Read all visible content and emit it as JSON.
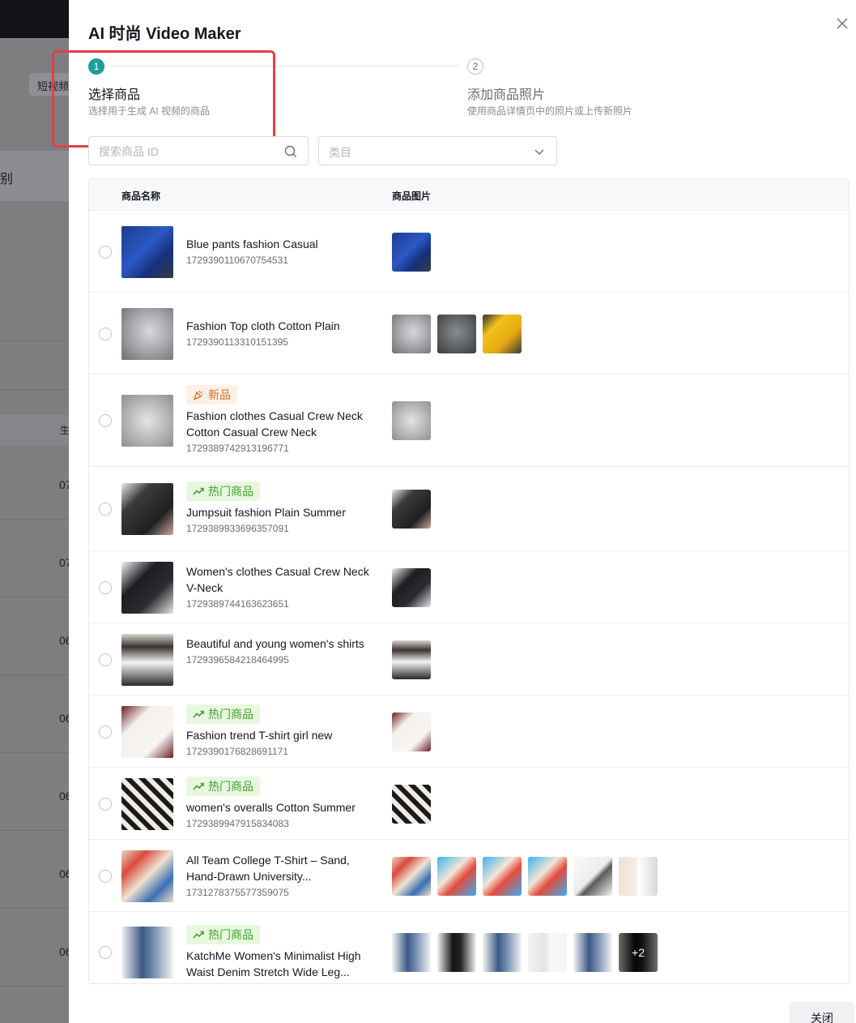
{
  "background": {
    "tab_label": "短视频",
    "side_char": "别",
    "col_char": "生",
    "row_marks": [
      "07",
      "07",
      "06",
      "06",
      "06",
      "06",
      "06"
    ]
  },
  "drawer": {
    "title": "AI 时尚 Video Maker",
    "close_icon": "close-icon",
    "steps": [
      {
        "number": "1",
        "label": "选择商品",
        "desc": "选择用于生成 AI 视频的商品",
        "state": "active"
      },
      {
        "number": "2",
        "label": "添加商品照片",
        "desc": "使用商品详情页中的照片或上传新照片",
        "state": "inactive"
      }
    ],
    "search": {
      "placeholder": "搜索商品 ID",
      "value": ""
    },
    "category": {
      "placeholder": "类目"
    },
    "table": {
      "headers": [
        "商品名称",
        "商品图片"
      ],
      "rows": [
        {
          "name": "Blue pants fashion Casual",
          "id": "1729390110670754531",
          "badge": null,
          "thumb": "c-blue",
          "images": [
            "c-blue"
          ]
        },
        {
          "name": "Fashion Top cloth Cotton Plain",
          "id": "1729390113310151395",
          "badge": null,
          "thumb": "c-grey1",
          "images": [
            "c-grey1",
            "c-grey2",
            "c-yellow"
          ]
        },
        {
          "name": "Fashion clothes Casual Crew Neck Cotton Casual Crew Neck",
          "id": "1729389742913196771",
          "badge": "新品",
          "badge_type": "new",
          "thumb": "c-clear",
          "images": [
            "c-clear"
          ]
        },
        {
          "name": "Jumpsuit fashion Plain Summer",
          "id": "1729389933696357091",
          "badge": "热门商品",
          "badge_type": "hot",
          "thumb": "c-black",
          "images": [
            "c-black"
          ]
        },
        {
          "name": "Women's clothes Casual Crew Neck V-Neck",
          "id": "1729389744163623651",
          "badge": null,
          "thumb": "c-dark",
          "images": [
            "c-dark"
          ]
        },
        {
          "name": "Beautiful and young women's shirts",
          "id": "1729396584218464995",
          "badge": null,
          "thumb": "c-woman",
          "images": [
            "c-woman"
          ]
        },
        {
          "name": "Fashion trend T-shirt girl new",
          "id": "1729390176828691171",
          "badge": "热门商品",
          "badge_type": "hot",
          "thumb": "c-tee",
          "images": [
            "c-tee"
          ]
        },
        {
          "name": "women's overalls Cotton Summer",
          "id": "1729389947915834083",
          "badge": "热门商品",
          "badge_type": "hot",
          "thumb": "c-pattern",
          "images": [
            "c-pattern"
          ]
        },
        {
          "name": "All Team College T-Shirt – Sand, Hand-Drawn University...",
          "id": "1731278375577359075",
          "badge": null,
          "thumb": "c-tshirts",
          "images": [
            "c-tshirts",
            "c-cyan",
            "c-cyan",
            "c-cyan",
            "c-white",
            "c-chart"
          ]
        },
        {
          "name": "KatchMe Women's Minimalist High Waist Denim Stretch Wide Leg...",
          "id": "",
          "badge": "热门商品",
          "badge_type": "hot",
          "thumb": "c-denim",
          "images": [
            "c-denim",
            "c-blackpants",
            "c-denim",
            "c-lightpants",
            "c-denim",
            "c-blackpants"
          ],
          "more_label": "+2"
        }
      ]
    },
    "footer": {
      "close_label": "关闭"
    }
  }
}
